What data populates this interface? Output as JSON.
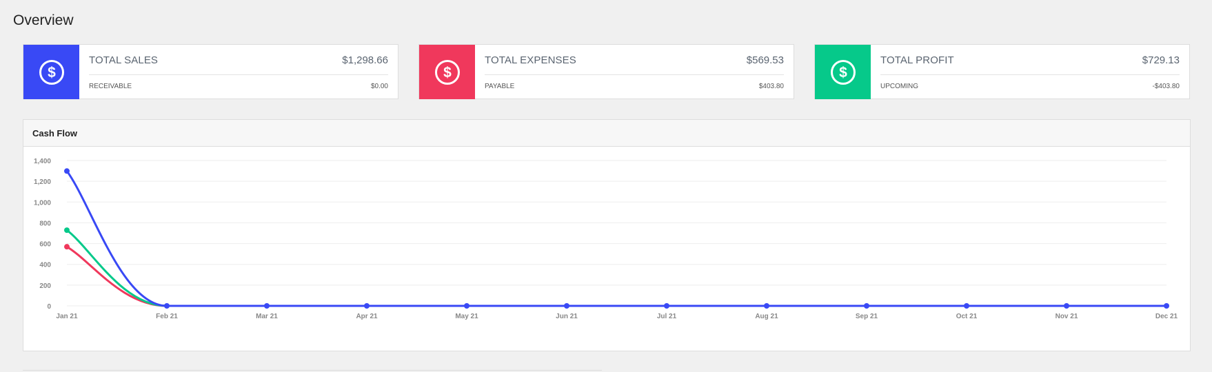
{
  "page": {
    "title": "Overview"
  },
  "cards": [
    {
      "title": "TOTAL SALES",
      "amount": "$1,298.66",
      "sub_label": "RECEIVABLE",
      "sub_value": "$0.00",
      "color": "#3949f5",
      "icon": "dollar-circle-icon"
    },
    {
      "title": "TOTAL EXPENSES",
      "amount": "$569.53",
      "sub_label": "PAYABLE",
      "sub_value": "$403.80",
      "color": "#f0385c",
      "icon": "dollar-circle-icon"
    },
    {
      "title": "TOTAL PROFIT",
      "amount": "$729.13",
      "sub_label": "UPCOMING",
      "sub_value": "-$403.80",
      "color": "#06c98a",
      "icon": "dollar-circle-icon"
    }
  ],
  "panel": {
    "title": "Cash Flow"
  },
  "chart_data": {
    "type": "line",
    "title": "",
    "xlabel": "",
    "ylabel": "",
    "categories": [
      "Jan 21",
      "Feb 21",
      "Mar 21",
      "Apr 21",
      "May 21",
      "Jun 21",
      "Jul 21",
      "Aug 21",
      "Sep 21",
      "Oct 21",
      "Nov 21",
      "Dec 21"
    ],
    "y_ticks": [
      "0",
      "200",
      "400",
      "600",
      "800",
      "1,000",
      "1,200",
      "1,400"
    ],
    "ylim": [
      0,
      1400
    ],
    "grid": true,
    "series": [
      {
        "color": "#f0385c",
        "values": [
          569.53,
          0,
          0,
          0,
          0,
          0,
          0,
          0,
          0,
          0,
          0,
          0
        ],
        "markers": "first"
      },
      {
        "color": "#06c98a",
        "values": [
          729.13,
          0,
          0,
          0,
          0,
          0,
          0,
          0,
          0,
          0,
          0,
          0
        ],
        "markers": "first"
      },
      {
        "color": "#3949f5",
        "values": [
          1298.66,
          0,
          0,
          0,
          0,
          0,
          0,
          0,
          0,
          0,
          0,
          0
        ],
        "markers": "all"
      }
    ]
  }
}
